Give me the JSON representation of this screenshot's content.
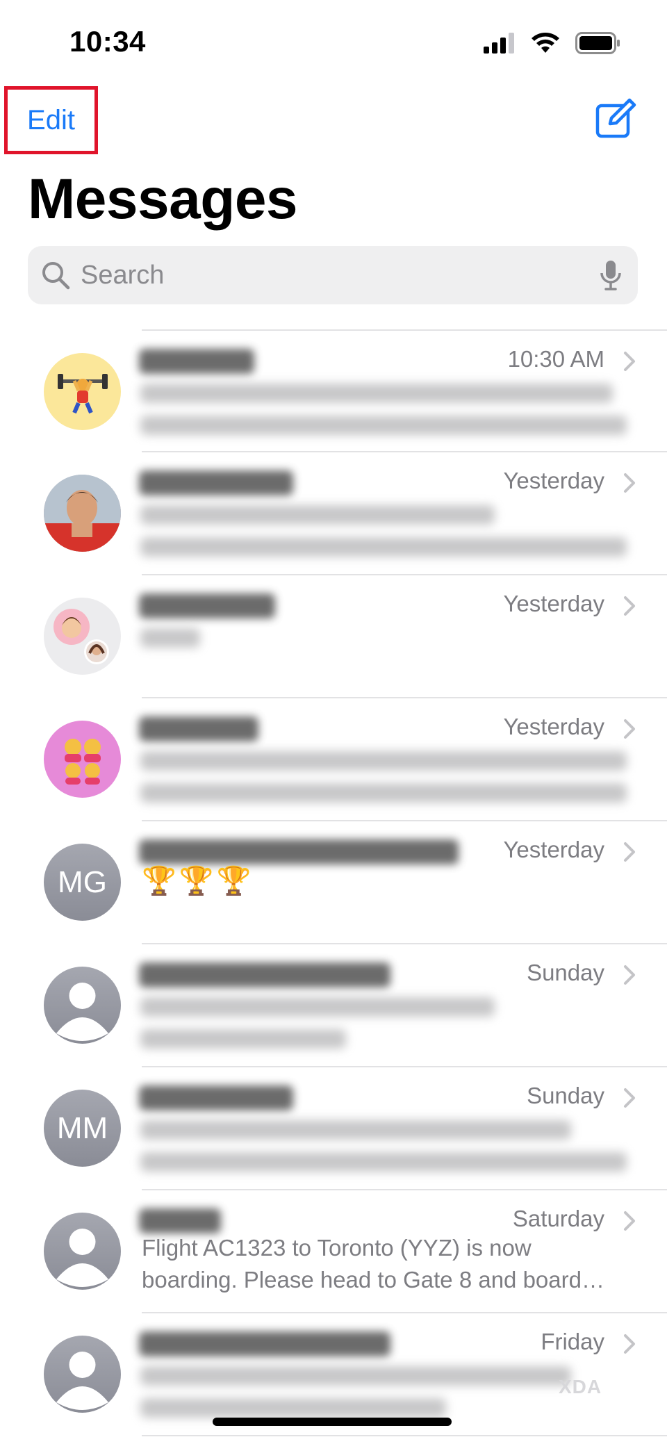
{
  "status_bar": {
    "time": "10:34",
    "signal_icon": "cellular-signal-icon",
    "wifi_icon": "wifi-icon",
    "battery_icon": "battery-icon"
  },
  "nav": {
    "edit_label": "Edit",
    "compose_icon": "compose-icon",
    "accent_color": "#1a7af8",
    "highlight_color": "#e0142b"
  },
  "title": "Messages",
  "search": {
    "placeholder": "Search",
    "value": "",
    "search_icon": "search-icon",
    "mic_icon": "microphone-icon"
  },
  "conversations": [
    {
      "time": "10:30 AM",
      "avatar": "emoji-weightlifter"
    },
    {
      "time": "Yesterday",
      "avatar": "photo-boy"
    },
    {
      "time": "Yesterday",
      "avatar": "group-memoji"
    },
    {
      "time": "Yesterday",
      "avatar": "emoji-family"
    },
    {
      "time": "Yesterday",
      "avatar_initials": "MG",
      "preview": "🏆🏆🏆"
    },
    {
      "time": "Sunday",
      "avatar": "person-icon"
    },
    {
      "time": "Sunday",
      "avatar_initials": "MM"
    },
    {
      "time": "Saturday",
      "avatar": "person-icon",
      "preview_line1": "Flight AC1323 to Toronto (YYZ) is now",
      "preview_line2": "boarding. Please head to Gate 8 and board…"
    },
    {
      "time": "Friday",
      "avatar": "person-icon"
    }
  ],
  "watermark": "XDA"
}
